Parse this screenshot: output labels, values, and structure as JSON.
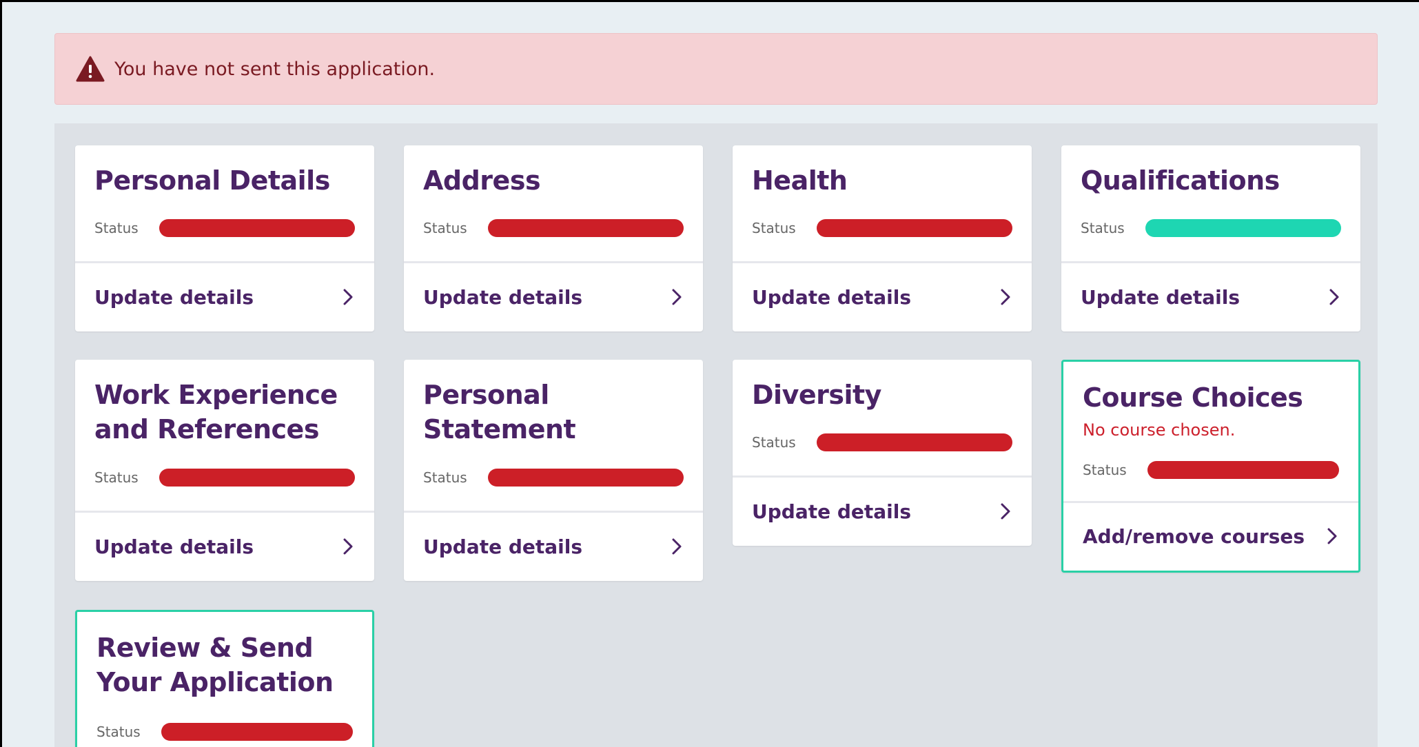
{
  "alert": {
    "icon": "warning-icon",
    "text": "You have not sent this application."
  },
  "colors": {
    "accent": "#4a2366",
    "danger": "#cc1f27",
    "success": "#1ed6b2",
    "highlight": "#2ad0a6"
  },
  "cards": [
    {
      "title": "Personal Details",
      "status_label": "Status",
      "status": "incomplete",
      "action": "Update details"
    },
    {
      "title": "Address",
      "status_label": "Status",
      "status": "incomplete",
      "action": "Update details"
    },
    {
      "title": "Health",
      "status_label": "Status",
      "status": "incomplete",
      "action": "Update details"
    },
    {
      "title": "Qualifications",
      "status_label": "Status",
      "status": "complete",
      "action": "Update details"
    },
    {
      "title": "Work Experience and References",
      "status_label": "Status",
      "status": "incomplete",
      "action": "Update details"
    },
    {
      "title": "Personal Statement",
      "status_label": "Status",
      "status": "incomplete",
      "action": "Update details"
    },
    {
      "title": "Diversity",
      "status_label": "Status",
      "status": "incomplete",
      "action": "Update details"
    },
    {
      "title": "Course Choices",
      "subtitle": "No course chosen.",
      "status_label": "Status",
      "status": "incomplete",
      "action": "Add/remove courses"
    },
    {
      "title": "Review & Send Your Application",
      "status_label": "Status",
      "status": "incomplete"
    }
  ]
}
